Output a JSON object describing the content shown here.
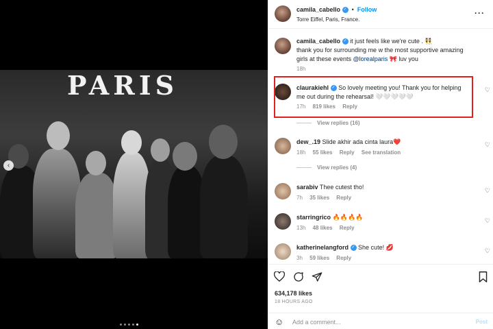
{
  "media": {
    "sign_text": "PARIS",
    "prev_icon": "chevron-left-icon",
    "carousel_dots": 5,
    "carousel_active_index": 4
  },
  "header": {
    "username": "camila_cabello",
    "follow_label": "Follow",
    "location": "Torre Eiffel, Paris, France.",
    "more_icon": "more-options-icon"
  },
  "caption": {
    "username": "camila_cabello",
    "line1": "it just feels like we're cute . 👯",
    "line2": "thank you for surrounding me w the most supportive amazing",
    "line3_pre": "girls at these events ",
    "mention": "@lorealparis",
    "line3_post": " 🎀 luv you",
    "time": "18h"
  },
  "comments": [
    {
      "username": "claurakiehl",
      "verified": true,
      "text1": "So lovely meeting you! Thank you for helping",
      "text2": "me out during the rehearsal! 🤍🤍🤍🤍🤍",
      "time": "17h",
      "likes": "819 likes",
      "reply": "Reply",
      "view_replies": "View replies (16)"
    },
    {
      "username": "dew_.19",
      "verified": false,
      "text1": "Slide akhir ada cinta laura❤️",
      "time": "18h",
      "likes": "55 likes",
      "reply": "Reply",
      "translation": "See translation",
      "view_replies": "View replies (4)"
    },
    {
      "username": "sarabiv",
      "verified": false,
      "text1": "Thee cutest tho!",
      "time": "7h",
      "likes": "35 likes",
      "reply": "Reply"
    },
    {
      "username": "starringrico",
      "verified": false,
      "text1": "🔥🔥🔥🔥",
      "time": "13h",
      "likes": "48 likes",
      "reply": "Reply"
    },
    {
      "username": "katherinelangford",
      "verified": true,
      "text1": "She cute! 💋",
      "time": "3h",
      "likes": "59 likes",
      "reply": "Reply"
    }
  ],
  "actions": {
    "likes": "634,178 likes",
    "time_ago": "18 HOURS AGO"
  },
  "add_comment": {
    "placeholder": "Add a comment...",
    "post_label": "Post"
  },
  "colors": {
    "link_blue": "#0095f6",
    "highlight_red": "#e0201f",
    "muted_gray": "#8e8e8e"
  }
}
